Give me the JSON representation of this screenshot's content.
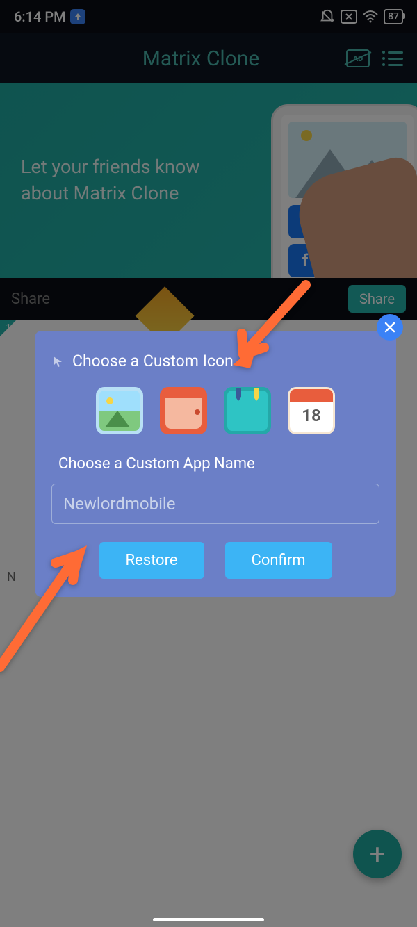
{
  "status": {
    "time": "6:14 PM",
    "battery": "87"
  },
  "header": {
    "title": "Matrix Clone"
  },
  "banner": {
    "text": "Let your friends know about Matrix Clone"
  },
  "share": {
    "label": "Share",
    "button": "Share"
  },
  "content": {
    "tag": "1",
    "n": "N"
  },
  "modal": {
    "title": "Choose a Custom Icon",
    "subtitle": "Choose a Custom App Name",
    "input_placeholder": "Newlordmobile",
    "restore": "Restore",
    "confirm": "Confirm",
    "calendar_num": "18",
    "icons": [
      "gallery",
      "wallet",
      "notes",
      "calendar"
    ]
  },
  "fab": {
    "label": "+"
  }
}
